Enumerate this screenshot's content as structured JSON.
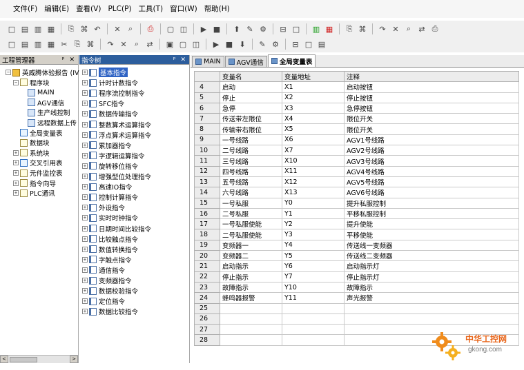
{
  "menu": [
    "文件(F)",
    "编辑(E)",
    "查看(V)",
    "PLC(P)",
    "工具(T)",
    "窗口(W)",
    "帮助(H)"
  ],
  "toolbar1_icons": [
    "new-file-icon",
    "open-folder-icon",
    "save-icon",
    "save-all-icon",
    "|",
    "cut-icon",
    "copy-icon",
    "paste-icon",
    "|",
    "undo-icon",
    "redo-icon",
    "|",
    "delete-icon",
    "|",
    "find-icon",
    "replace-icon",
    "|",
    "print-preview-icon",
    "print-icon",
    "|",
    "view-a-icon",
    "view-b-icon",
    "view-c-icon",
    "|",
    "check-icon",
    "compile-icon",
    "|",
    "run-icon",
    "stop-icon",
    "|",
    "download-icon",
    "upload-icon",
    "|",
    "monitor-icon",
    "edit-icon",
    "lock-icon",
    "unlock-icon",
    "settings-icon"
  ],
  "toolbar2_icons": [
    "ladder-a-icon",
    "ladder-b-icon",
    "contact-no-icon",
    "contact-nc-icon",
    "contact-p-icon",
    "contact-n-icon",
    "contact-inv-icon",
    "|",
    "coil-out-icon",
    "coil-set-icon",
    "coil-reset-icon",
    "coil-fn-icon",
    "|",
    "line-v-icon",
    "line-h-icon",
    "line-del-icon",
    "|",
    "box-a-icon",
    "box-b-icon",
    "box-c-icon",
    "|",
    "branch-a-icon",
    "branch-b-icon",
    "|",
    "hline-icon",
    "vline-icon",
    "del-line-icon"
  ],
  "project": {
    "title": "工程管理器",
    "pin": "ᵖ ✕",
    "scroll_left": "<",
    "scroll_right": ">",
    "tree": [
      {
        "level": 0,
        "exp": "−",
        "icon": "proj",
        "label": "英威腾体验报告 (IV"
      },
      {
        "level": 1,
        "exp": "−",
        "icon": "doc",
        "label": "程序块"
      },
      {
        "level": 2,
        "exp": "",
        "icon": "prog",
        "label": "MAIN"
      },
      {
        "level": 2,
        "exp": "",
        "icon": "prog",
        "label": "AGV通信"
      },
      {
        "level": 2,
        "exp": "",
        "icon": "prog",
        "label": "生产线控制"
      },
      {
        "level": 2,
        "exp": "",
        "icon": "prog",
        "label": "远程数据上传"
      },
      {
        "level": 1,
        "exp": "",
        "icon": "chk",
        "label": "全局变量表"
      },
      {
        "level": 1,
        "exp": "",
        "icon": "doc",
        "label": "数据块"
      },
      {
        "level": 1,
        "exp": "+",
        "icon": "doc",
        "label": "系统块"
      },
      {
        "level": 1,
        "exp": "+",
        "icon": "chk",
        "label": "交叉引用表"
      },
      {
        "level": 1,
        "exp": "+",
        "icon": "doc",
        "label": "元件监控表"
      },
      {
        "level": 1,
        "exp": "+",
        "icon": "doc",
        "label": "指令向导"
      },
      {
        "level": 1,
        "exp": "+",
        "icon": "doc",
        "label": "PLC通讯"
      }
    ]
  },
  "instructions": {
    "title": "指令树",
    "pin": "ᵖ ✕",
    "items": [
      "基本指令",
      "计时计数指令",
      "程序流控制指令",
      "SFC指令",
      "数据传输指令",
      "整数算术运算指令",
      "浮点算术运算指令",
      "累加器指令",
      "字逻辑运算指令",
      "旋转移位指令",
      "增强型位处理指令",
      "高速IO指令",
      "控制计算指令",
      "外设指令",
      "实时时钟指令",
      "日期时间比较指令",
      "比较触点指令",
      "数值转换指令",
      "字触点指令",
      "通信指令",
      "变频器指令",
      "数据校验指令",
      "定位指令",
      "数据比较指令"
    ]
  },
  "tabs": [
    "MAIN",
    "AGV通信",
    "全局变量表"
  ],
  "table": {
    "headers": [
      "",
      "变量名",
      "变量地址",
      "注释"
    ],
    "rows": [
      [
        "4",
        "启动",
        "X1",
        "启动按钮"
      ],
      [
        "5",
        "停止",
        "X2",
        "停止按钮"
      ],
      [
        "6",
        "急停",
        "X3",
        "急停按钮"
      ],
      [
        "7",
        "传送带左限位",
        "X4",
        "限位开关"
      ],
      [
        "8",
        "传输带右限位",
        "X5",
        "限位开关"
      ],
      [
        "9",
        "一号线路",
        "X6",
        "AGV1号线路"
      ],
      [
        "10",
        "二号线路",
        "X7",
        "AGV2号线路"
      ],
      [
        "11",
        "三号线路",
        "X10",
        "AGV3号线路"
      ],
      [
        "12",
        "四号线路",
        "X11",
        "AGV4号线路"
      ],
      [
        "13",
        "五号线路",
        "X12",
        "AGV5号线路"
      ],
      [
        "14",
        "六号线路",
        "X13",
        "AGV6号线路"
      ],
      [
        "15",
        "一号私服",
        "Y0",
        "提升私服控制"
      ],
      [
        "16",
        "二号私服",
        "Y1",
        "平移私服控制"
      ],
      [
        "17",
        "一号私服使能",
        "Y2",
        "提升使能"
      ],
      [
        "18",
        "二号私服使能",
        "Y3",
        "平移使能"
      ],
      [
        "19",
        "变频器一",
        "Y4",
        "传送线一变频器"
      ],
      [
        "20",
        "变频器二",
        "Y5",
        "传送线二变频器"
      ],
      [
        "21",
        "启动指示",
        "Y6",
        "启动指示灯"
      ],
      [
        "22",
        "停止指示",
        "Y7",
        "停止指示灯"
      ],
      [
        "23",
        "故障指示",
        "Y10",
        "故障指示"
      ],
      [
        "24",
        "蜂鸣器报警",
        "Y11",
        "声光报警"
      ],
      [
        "25",
        "",
        "",
        ""
      ],
      [
        "26",
        "",
        "",
        ""
      ],
      [
        "27",
        "",
        "",
        ""
      ],
      [
        "28",
        "",
        "",
        ""
      ]
    ]
  },
  "watermark": {
    "title": "中华工控网",
    "url": "gkong.com"
  }
}
